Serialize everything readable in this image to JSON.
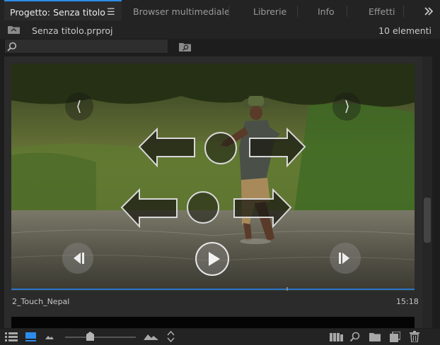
{
  "tabs": [
    {
      "label": "Progetto: Senza titolo",
      "active": true
    },
    {
      "label": "Browser multimediale"
    },
    {
      "label": "Librerie"
    },
    {
      "label": "Info"
    },
    {
      "label": "Effetti"
    }
  ],
  "tab_menu_icon": "hamburger-menu-icon",
  "overflow_icon": "double-chevron-right-icon",
  "project": {
    "file_name": "Senza titolo.prproj",
    "item_count": "10 elementi"
  },
  "search": {
    "value": "",
    "placeholder": ""
  },
  "clip": {
    "name": "2_Touch_Nepal",
    "duration": "15:18",
    "playhead_fraction": 0.685
  },
  "toolbar": {
    "zoom_slider_fraction": 0.35
  },
  "colors": {
    "accent": "#2d8ceb",
    "panel_bg": "#232323",
    "content_bg": "#2b2b2b"
  }
}
